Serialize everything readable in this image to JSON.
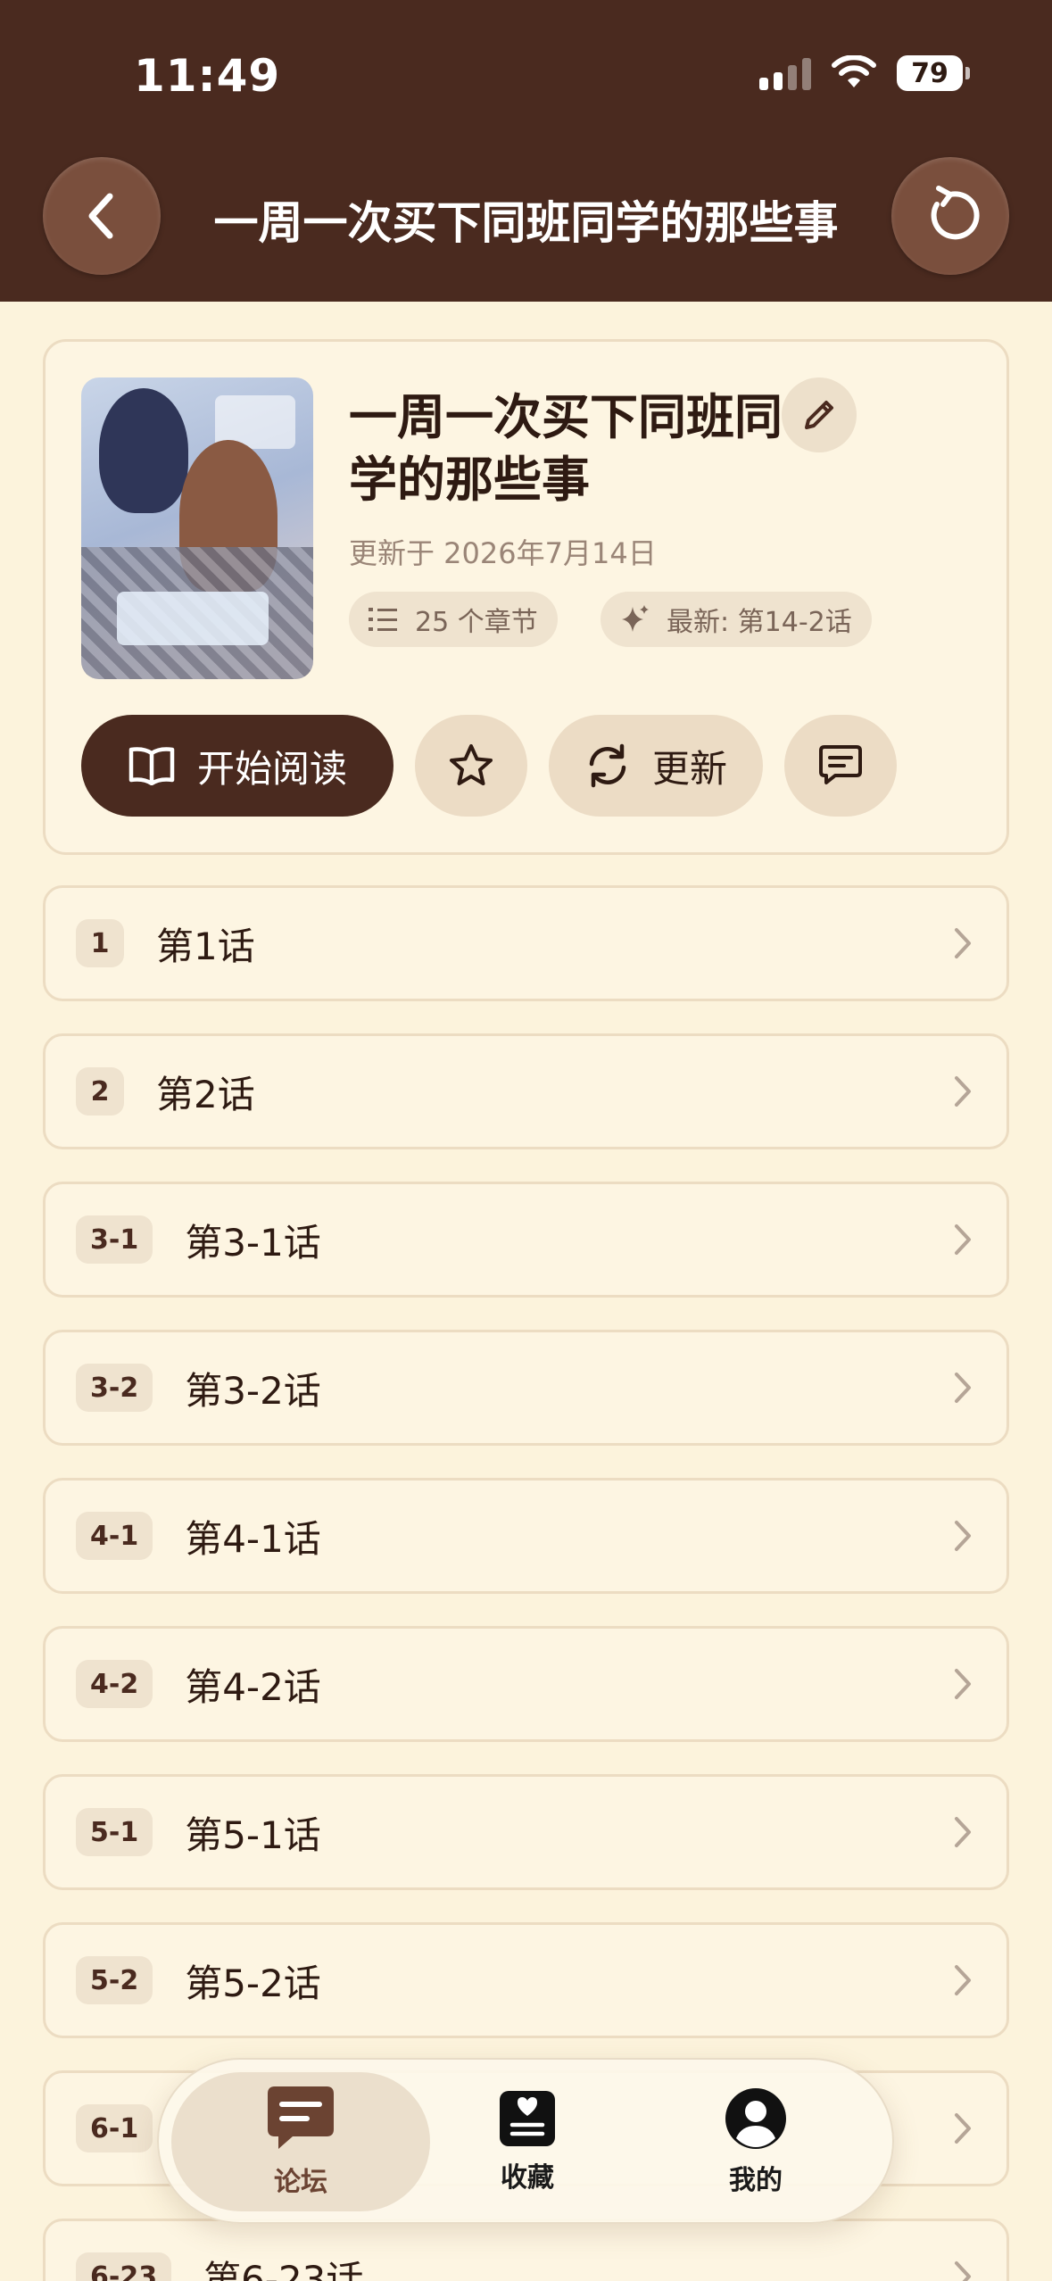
{
  "status_bar": {
    "time": "11:49",
    "battery": "79"
  },
  "header": {
    "title": "一周一次买下同班同学的那些事"
  },
  "book": {
    "title": "一周一次买下同班同学的那些事",
    "updated": "更新于 2026年7月14日",
    "chapter_count": "25 个章节",
    "latest": "最新: 第14-2话"
  },
  "actions": {
    "read_label": "开始阅读",
    "update_label": "更新"
  },
  "chapters": [
    {
      "badge": "1",
      "title": "第1话"
    },
    {
      "badge": "2",
      "title": "第2话"
    },
    {
      "badge": "3-1",
      "title": "第3-1话"
    },
    {
      "badge": "3-2",
      "title": "第3-2话"
    },
    {
      "badge": "4-1",
      "title": "第4-1话"
    },
    {
      "badge": "4-2",
      "title": "第4-2话"
    },
    {
      "badge": "5-1",
      "title": "第5-1话"
    },
    {
      "badge": "5-2",
      "title": "第5-2话"
    },
    {
      "badge": "6-1",
      "title": ""
    },
    {
      "badge": "6-23",
      "title": "第6-23话"
    }
  ],
  "tabbar": {
    "forum": "论坛",
    "favorites": "收藏",
    "me": "我的"
  },
  "colors": {
    "header_bg": "#4a2a1f",
    "page_bg": "#fcf3dc",
    "accent": "#4a2a1f",
    "card_border": "#ecdcc2"
  },
  "icons": [
    "back-icon",
    "refresh-icon",
    "edit-icon",
    "list-icon",
    "sparkle-icon",
    "book-icon",
    "star-icon",
    "sync-icon",
    "comment-icon",
    "chevron-right-icon",
    "forum-icon",
    "favorites-icon",
    "profile-icon"
  ]
}
